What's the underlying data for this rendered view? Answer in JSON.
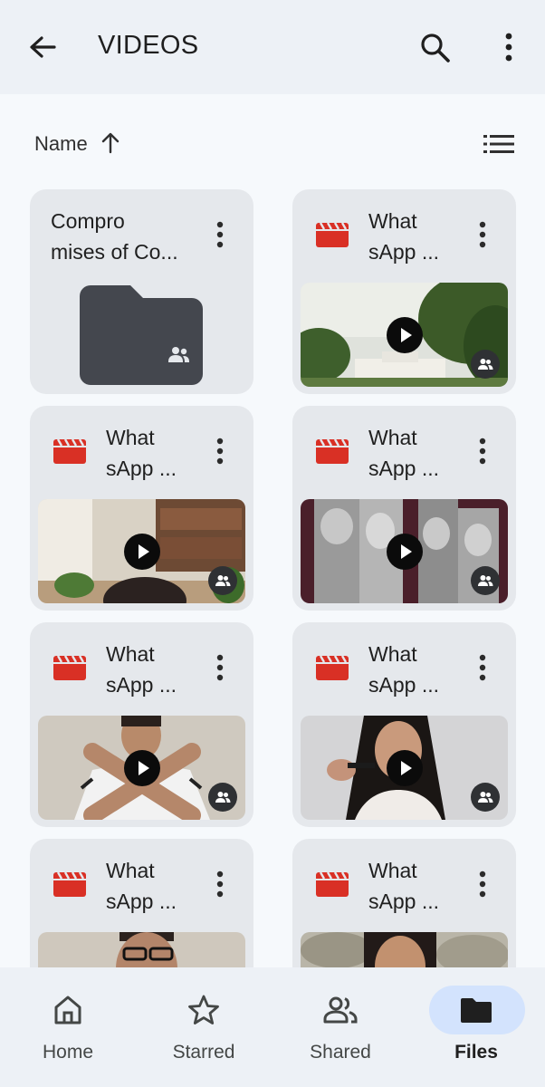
{
  "appbar": {
    "title": "VIDEOS",
    "back_icon": "arrow-back-icon",
    "search_icon": "search-icon",
    "more_icon": "more-vert-icon"
  },
  "sort": {
    "label": "Name",
    "direction": "ascending",
    "view_icon": "list-view-icon"
  },
  "items": [
    {
      "type": "folder",
      "title": "Compro\nmises of Co...",
      "shared": true
    },
    {
      "type": "video",
      "title": "What\nsApp ...",
      "shared": true,
      "thumb": "white-house"
    },
    {
      "type": "video",
      "title": "What\nsApp ...",
      "shared": true,
      "thumb": "room"
    },
    {
      "type": "video",
      "title": "What\nsApp ...",
      "shared": true,
      "thumb": "leaders"
    },
    {
      "type": "video",
      "title": "What\nsApp ...",
      "shared": true,
      "thumb": "man-cross"
    },
    {
      "type": "video",
      "title": "What\nsApp ...",
      "shared": true,
      "thumb": "woman-talk"
    },
    {
      "type": "video",
      "title": "What\nsApp ...",
      "shared": false,
      "thumb": "man-glasses"
    },
    {
      "type": "video",
      "title": "What\nsApp ...",
      "shared": false,
      "thumb": "woman-portrait"
    }
  ],
  "colors": {
    "video_icon": "#d93025",
    "folder": "#44474e",
    "active_nav": "#d3e3fd",
    "background": "#f6f9fc",
    "card": "#e5e8ec"
  },
  "nav": [
    {
      "label": "Home",
      "icon": "home-icon",
      "active": false
    },
    {
      "label": "Starred",
      "icon": "star-icon",
      "active": false
    },
    {
      "label": "Shared",
      "icon": "people-icon",
      "active": false
    },
    {
      "label": "Files",
      "icon": "folder-icon",
      "active": true
    }
  ]
}
